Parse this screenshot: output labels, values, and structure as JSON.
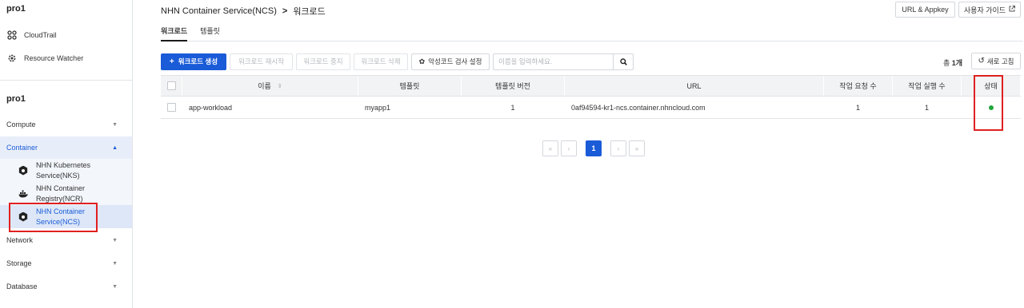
{
  "sidebar": {
    "org_title": "pro1",
    "top_items": [
      {
        "label": "CloudTrail",
        "icon": "cloudtrail-icon"
      },
      {
        "label": "Resource Watcher",
        "icon": "gear-icon"
      }
    ],
    "project_title": "pro1",
    "categories": [
      {
        "label": "Compute",
        "expanded": false
      },
      {
        "label": "Container",
        "expanded": true
      },
      {
        "label": "Network",
        "expanded": false
      },
      {
        "label": "Storage",
        "expanded": false
      },
      {
        "label": "Database",
        "expanded": false
      }
    ],
    "container_items": [
      {
        "label1": "NHN Kubernetes",
        "label2": "Service(NKS)"
      },
      {
        "label1": "NHN Container",
        "label2": "Registry(NCR)"
      },
      {
        "label1": "NHN Container",
        "label2": "Service(NCS)"
      }
    ]
  },
  "header": {
    "service": "NHN Container Service(NCS)",
    "separator": ">",
    "page": "워크로드",
    "url_appkey": "URL & Appkey",
    "user_guide": "사용자 가이드"
  },
  "tabs": [
    {
      "label": "워크로드",
      "active": true
    },
    {
      "label": "템플릿",
      "active": false
    }
  ],
  "toolbar": {
    "create": "워크로드 생성",
    "restart": "워크로드 재시작",
    "stop": "워크로드 중지",
    "delete": "워크로드 삭제",
    "malware_setting": "악성코드 검사 설정",
    "search_placeholder": "이름을 입력하세요.",
    "total_prefix": "총 ",
    "total_count": "1개",
    "refresh": "새로 고침"
  },
  "table": {
    "columns": [
      "이름",
      "템플릿",
      "템플릿 버전",
      "URL",
      "작업 요청 수",
      "작업 실행 수",
      "상태"
    ],
    "rows": [
      {
        "name": "app-workload",
        "template": "myapp1",
        "template_version": "1",
        "url": "0af94594-kr1-ncs.container.nhncloud.com",
        "requests": "1",
        "executions": "1",
        "status": "running"
      }
    ]
  },
  "pagination": {
    "first": "«",
    "prev": "‹",
    "current": "1",
    "next": "›",
    "last": "»"
  },
  "colors": {
    "accent": "#1a5bd8",
    "status_ok": "#22a63a",
    "highlight": "#e02020"
  }
}
